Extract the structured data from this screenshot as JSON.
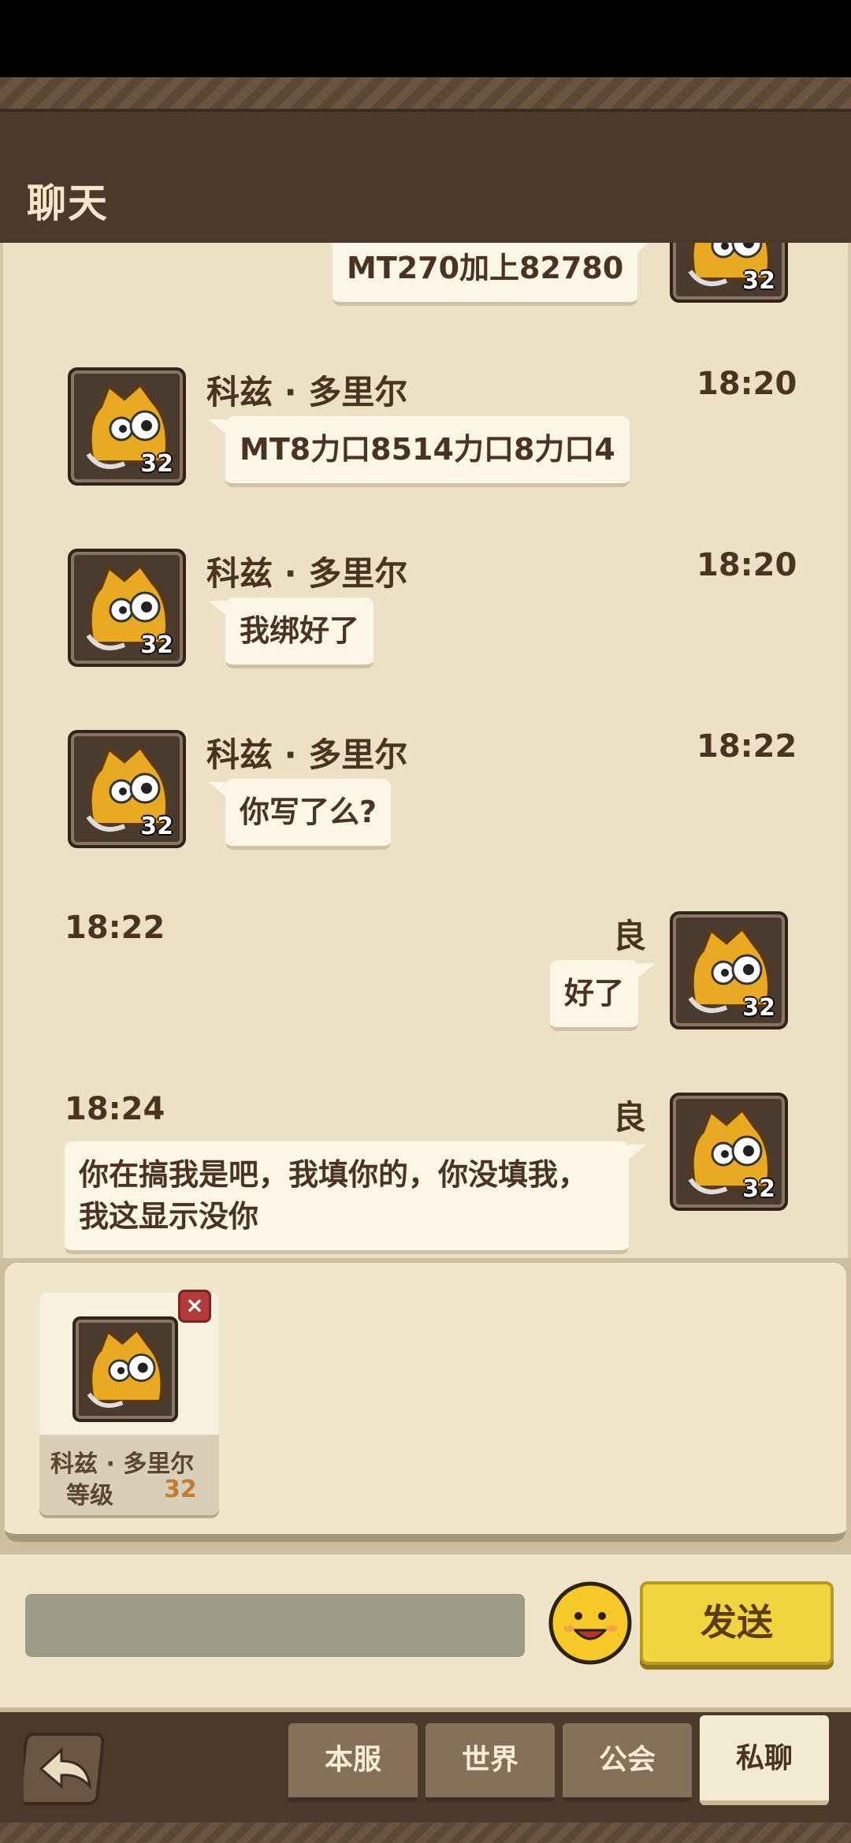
{
  "header": {
    "title": "聊天"
  },
  "messages": [
    {
      "side": "right",
      "text": "MT270加上82780",
      "level": "32"
    },
    {
      "side": "left",
      "name": "科兹 · 多里尔",
      "time": "18:20",
      "text": "MT8力口8514力口8力口4",
      "level": "32"
    },
    {
      "side": "left",
      "name": "科兹 · 多里尔",
      "time": "18:20",
      "text": "我绑好了",
      "level": "32"
    },
    {
      "side": "left",
      "name": "科兹 · 多里尔",
      "time": "18:22",
      "text": "你写了么?",
      "level": "32"
    },
    {
      "side": "right",
      "name": "良",
      "time": "18:22",
      "text": "好了",
      "level": "32"
    },
    {
      "side": "right",
      "name": "良",
      "time": "18:24",
      "text": "你在搞我是吧，我填你的，你没填我，我这显示没你",
      "level": "32"
    }
  ],
  "invite_card": {
    "name": "科兹 · 多里尔",
    "level_label": "等级",
    "level": "32",
    "close": "×"
  },
  "input": {
    "value": "",
    "placeholder": ""
  },
  "send_label": "发送",
  "tabs": [
    {
      "label": "本服",
      "active": false
    },
    {
      "label": "世界",
      "active": false
    },
    {
      "label": "公会",
      "active": false
    },
    {
      "label": "私聊",
      "active": true
    }
  ],
  "colors": {
    "accent": "#f2d43f",
    "brand": "#4b3a2c",
    "chat_bg": "#ece1c5"
  }
}
